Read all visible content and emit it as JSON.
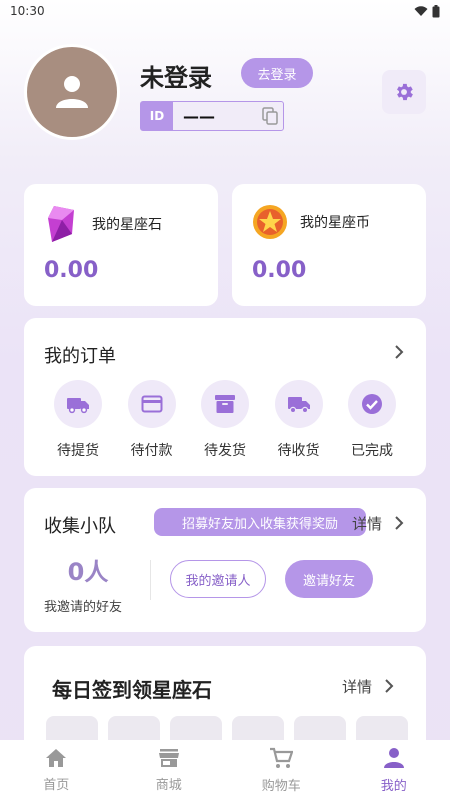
{
  "status": {
    "time": "10:30"
  },
  "profile": {
    "name": "未登录",
    "login_label": "去登录",
    "id_tag": "ID",
    "id_value": "——"
  },
  "wallet": [
    {
      "label": "我的星座石",
      "value": "0.00",
      "icon": "gem-icon"
    },
    {
      "label": "我的星座币",
      "value": "0.00",
      "icon": "star-coin-icon"
    }
  ],
  "orders": {
    "title": "我的订单",
    "items": [
      {
        "label": "待提货",
        "icon": "truck-icon"
      },
      {
        "label": "待付款",
        "icon": "card-icon"
      },
      {
        "label": "待发货",
        "icon": "box-icon"
      },
      {
        "label": "待收货",
        "icon": "delivery-truck-icon"
      },
      {
        "label": "已完成",
        "icon": "check-icon"
      }
    ]
  },
  "team": {
    "title": "收集小队",
    "banner": "招募好友加入收集获得奖励",
    "detail": "详情",
    "count": "0人",
    "count_label": "我邀请的好友",
    "my_invites": "我的邀请人",
    "invite_btn": "邀请好友"
  },
  "signin": {
    "title": "每日签到领星座石",
    "detail": "详情"
  },
  "tabs": [
    {
      "label": "首页",
      "icon": "home-icon"
    },
    {
      "label": "商城",
      "icon": "store-icon"
    },
    {
      "label": "购物车",
      "icon": "cart-icon"
    },
    {
      "label": "我的",
      "icon": "person-icon",
      "active": true
    }
  ],
  "colors": {
    "accent": "#b596e8",
    "accent_dark": "#8760c8"
  }
}
